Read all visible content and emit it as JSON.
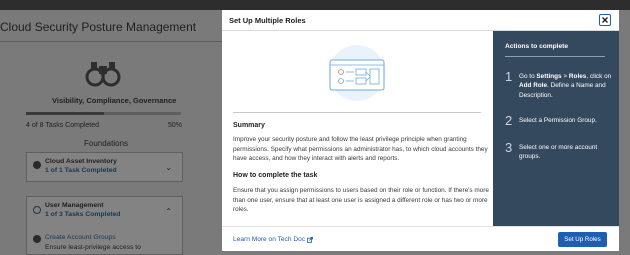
{
  "background": {
    "page_title": "Cloud Security Posture Management",
    "section_caption": "Visibility, Compliance, Governance",
    "tasks_completed_text": "4 of 8 Tasks Completed",
    "tasks_percent": "50%",
    "tasks_progress_fraction": 0.5,
    "group_heading": "Foundations",
    "cards": [
      {
        "title": "Cloud Asset Inventory",
        "subtitle": "1 of 1 Task Completed",
        "expanded": false
      },
      {
        "title": "User Management",
        "subtitle": "1 of 3 Tasks Completed",
        "expanded": true,
        "subtasks": [
          {
            "label": "Create Account Groups",
            "description": "Ensure least-privilege access to"
          }
        ]
      }
    ],
    "icons": {
      "hero": "binoculars-icon",
      "collapsed": "chevron-down-icon",
      "expanded": "chevron-up-icon"
    }
  },
  "modal": {
    "title": "Set Up Multiple Roles",
    "close_icon": "close-icon",
    "summary_heading": "Summary",
    "summary_text": "Improve your security posture and follow the least privilege principle when granting permissions. Specify what permissions an administrator has, to which cloud accounts they have access, and how they interact with alerts and reports.",
    "how_heading": "How to complete the task",
    "how_text": "Ensure that you assign permissions to users based on their role or function. If there's more than one user, ensure that at least one user is assigned a different role or has two or more roles.",
    "actions": {
      "title": "Actions to complete",
      "steps": [
        {
          "num": "1",
          "parts": [
            {
              "t": "Go to ",
              "b": false
            },
            {
              "t": "Settings",
              "b": true
            },
            {
              "t": " > ",
              "b": false
            },
            {
              "t": "Roles",
              "b": true
            },
            {
              "t": ", click on ",
              "b": false
            },
            {
              "t": "Add Role",
              "b": true
            },
            {
              "t": ". Define a Name and Description.",
              "b": false
            }
          ]
        },
        {
          "num": "2",
          "parts": [
            {
              "t": "Select a Permission Group.",
              "b": false
            }
          ]
        },
        {
          "num": "3",
          "parts": [
            {
              "t": "Select one or more account groups.",
              "b": false
            }
          ]
        }
      ]
    },
    "footer": {
      "learn_more": "Learn More on Tech Doc",
      "learn_more_icon": "external-link-icon",
      "primary_button": "Set Up Roles"
    },
    "colors": {
      "accent": "#1e5fb3",
      "sidebar": "#34495e"
    }
  }
}
